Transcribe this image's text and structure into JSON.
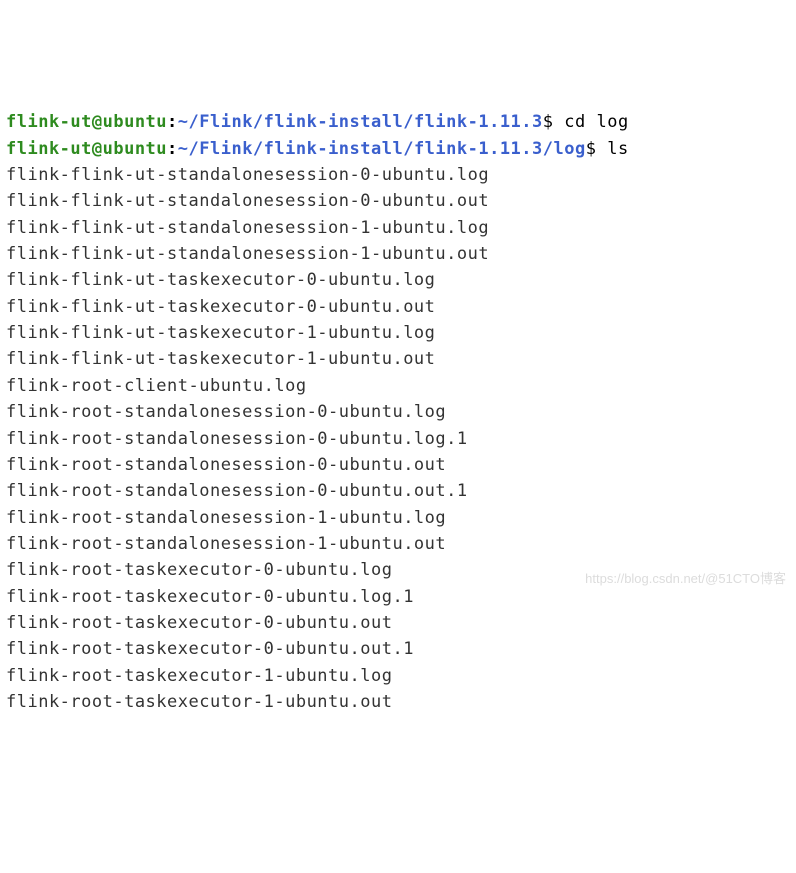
{
  "prompt1": {
    "user_host": "flink-ut@ubuntu",
    "colon": ":",
    "path": "~/Flink/flink-install/flink-1.11.3",
    "dollar": "$ ",
    "command": "cd log"
  },
  "prompt2": {
    "user_host": "flink-ut@ubuntu",
    "colon": ":",
    "path": "~/Flink/flink-install/flink-1.11.3/log",
    "dollar": "$ ",
    "command": "ls"
  },
  "files": [
    "flink-flink-ut-standalonesession-0-ubuntu.log",
    "flink-flink-ut-standalonesession-0-ubuntu.out",
    "flink-flink-ut-standalonesession-1-ubuntu.log",
    "flink-flink-ut-standalonesession-1-ubuntu.out",
    "flink-flink-ut-taskexecutor-0-ubuntu.log",
    "flink-flink-ut-taskexecutor-0-ubuntu.out",
    "flink-flink-ut-taskexecutor-1-ubuntu.log",
    "flink-flink-ut-taskexecutor-1-ubuntu.out",
    "flink-root-client-ubuntu.log",
    "flink-root-standalonesession-0-ubuntu.log",
    "flink-root-standalonesession-0-ubuntu.log.1",
    "flink-root-standalonesession-0-ubuntu.out",
    "flink-root-standalonesession-0-ubuntu.out.1",
    "flink-root-standalonesession-1-ubuntu.log",
    "flink-root-standalonesession-1-ubuntu.out",
    "flink-root-taskexecutor-0-ubuntu.log",
    "flink-root-taskexecutor-0-ubuntu.log.1",
    "flink-root-taskexecutor-0-ubuntu.out",
    "flink-root-taskexecutor-0-ubuntu.out.1",
    "flink-root-taskexecutor-1-ubuntu.log",
    "flink-root-taskexecutor-1-ubuntu.out"
  ],
  "watermark": "https://blog.csdn.net/@51CTO博客"
}
